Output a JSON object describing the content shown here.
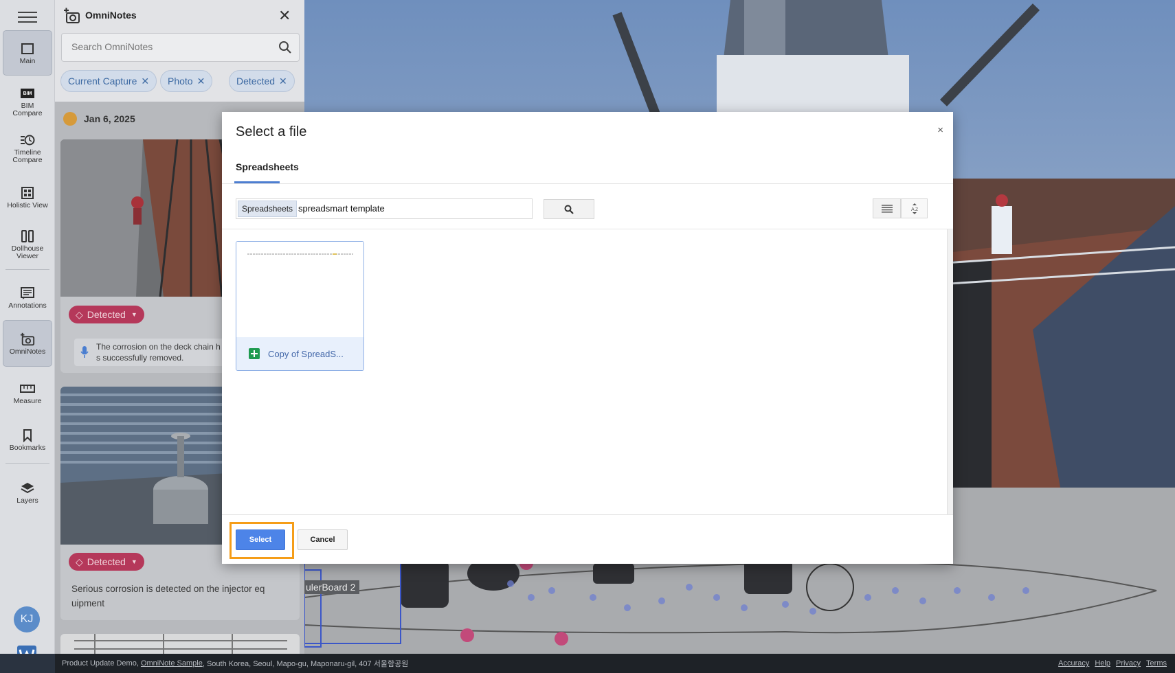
{
  "rail": {
    "items": [
      {
        "label": "Main"
      },
      {
        "label": "BIM Compare",
        "badge": "BIM"
      },
      {
        "label": "Timeline Compare"
      },
      {
        "label": "Holistic View"
      },
      {
        "label": "Dollhouse Viewer"
      },
      {
        "label": "Annotations"
      },
      {
        "label": "OmniNotes"
      },
      {
        "label": "Measure"
      },
      {
        "label": "Bookmarks"
      },
      {
        "label": "Layers"
      }
    ],
    "avatar": "KJ"
  },
  "panel": {
    "title": "OmniNotes",
    "search_placeholder": "Search OmniNotes",
    "chips": [
      {
        "label": "Current Capture"
      },
      {
        "label": "Photo"
      },
      {
        "label": "Detected"
      }
    ],
    "date": "Jan 6, 2025",
    "cards": [
      {
        "tag": "Detected",
        "text": "The corrosion on the deck chain h\ns successfully removed."
      },
      {
        "tag": "Detected",
        "text": "Serious corrosion is detected on the injector eq\nuipment"
      }
    ]
  },
  "plan": {
    "label": "ulerBoard 2"
  },
  "footer": {
    "prefix": "Product Update Demo, ",
    "link": "OmniNote Sample",
    "address": ", South Korea, Seoul, Mapo-gu, Maponaru-gil, 407 서울함공원",
    "links": [
      "Accuracy",
      "Help",
      "Privacy",
      "Terms"
    ]
  },
  "dialog": {
    "title": "Select a file",
    "close": "×",
    "tab": "Spreadsheets",
    "scope": "Spreadsheets",
    "query": "spreadsmart template",
    "files": [
      {
        "name": "Copy of SpreadS..."
      }
    ],
    "select_label": "Select",
    "cancel_label": "Cancel"
  },
  "colors": {
    "accent": "#4d84e8",
    "highlight": "#f59d18",
    "tag": "#b5385a",
    "chip": "#3d6aa3"
  }
}
